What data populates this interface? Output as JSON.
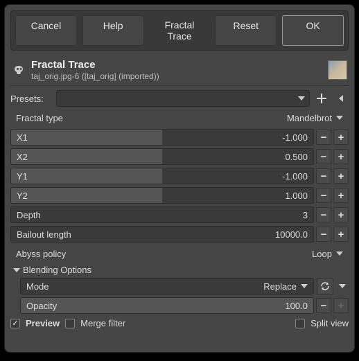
{
  "buttons": {
    "cancel": "Cancel",
    "help": "Help",
    "title_tab": "Fractal Trace",
    "reset": "Reset",
    "ok": "OK"
  },
  "header": {
    "title": "Fractal Trace",
    "subtitle": "taj_orig.jpg-6 ([taj_orig] (imported))"
  },
  "presets": {
    "label": "Presets:",
    "value": ""
  },
  "fractal_type": {
    "label": "Fractal type",
    "value": "Mandelbrot"
  },
  "params": {
    "x1": {
      "label": "X1",
      "value": "-1.000",
      "fill": 50
    },
    "x2": {
      "label": "X2",
      "value": "0.500",
      "fill": 50
    },
    "y1": {
      "label": "Y1",
      "value": "-1.000",
      "fill": 50
    },
    "y2": {
      "label": "Y2",
      "value": "1.000",
      "fill": 50
    },
    "depth": {
      "label": "Depth",
      "value": "3"
    },
    "bailout": {
      "label": "Bailout length",
      "value": "10000.0"
    }
  },
  "abyss": {
    "label": "Abyss policy",
    "value": "Loop"
  },
  "blending": {
    "section": "Blending Options",
    "mode_label": "Mode",
    "mode_value": "Replace",
    "opacity_label": "Opacity",
    "opacity_value": "100.0"
  },
  "footer": {
    "preview": "Preview",
    "merge": "Merge filter",
    "split": "Split view"
  }
}
